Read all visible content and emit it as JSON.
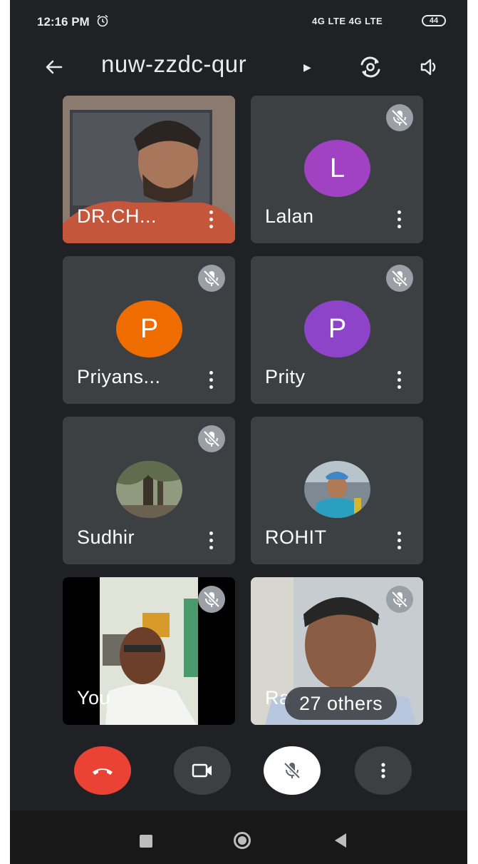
{
  "status_bar": {
    "time": "12:16 PM",
    "network": "4G LTE 4G LTE",
    "battery": "44"
  },
  "header": {
    "meeting_code": "nuw-zzdc-qur",
    "icons": [
      "back-arrow-icon",
      "switch-camera-icon",
      "speaker-icon"
    ]
  },
  "participants": [
    {
      "name": "DR.CH...",
      "type": "video",
      "muted": false
    },
    {
      "name": "Lalan",
      "type": "initial",
      "initial": "L",
      "color": "#a142c3",
      "muted": true
    },
    {
      "name": "Priyans...",
      "type": "initial",
      "initial": "P",
      "color": "#ef6c00",
      "muted": true
    },
    {
      "name": "Prity",
      "type": "initial",
      "initial": "P",
      "color": "#8e44c8",
      "muted": true
    },
    {
      "name": "Sudhir",
      "type": "photo",
      "muted": true
    },
    {
      "name": "ROHIT",
      "type": "photo",
      "muted": false
    },
    {
      "name": "You",
      "type": "video",
      "muted": true
    },
    {
      "name": "Ra",
      "type": "video",
      "muted": true
    }
  ],
  "others_chip": "27 others",
  "controls": {
    "end_call_color": "#ea4335",
    "icons": [
      "end-call-icon",
      "camera-icon",
      "mic-off-icon",
      "more-options-icon"
    ]
  }
}
